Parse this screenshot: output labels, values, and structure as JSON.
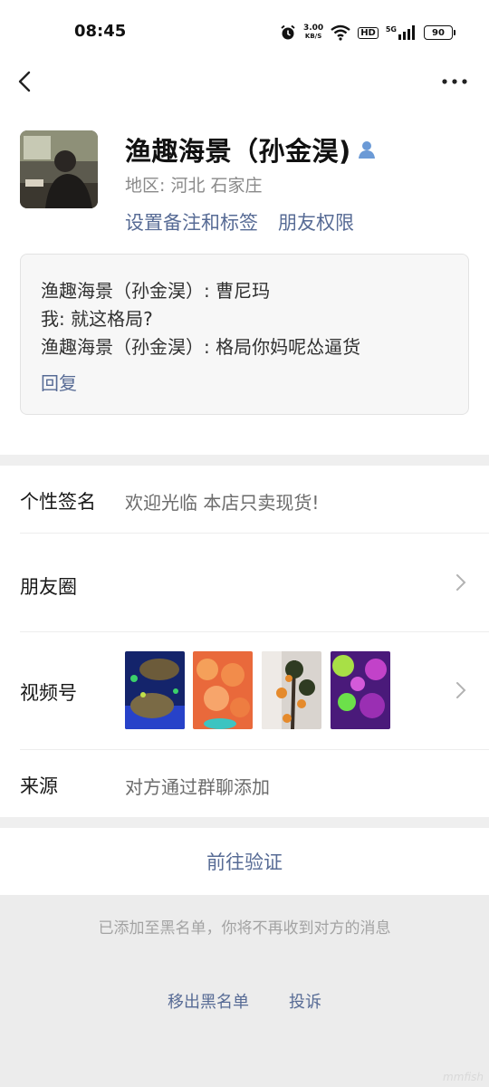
{
  "status_bar": {
    "time": "08:45",
    "net_speed_value": "3.00",
    "net_speed_unit": "KB/S",
    "hd_label": "HD",
    "network_label": "5G",
    "battery": "90"
  },
  "profile": {
    "name": "渔趣海景（孙金淏)",
    "region": "地区: 河北  石家庄",
    "set_remark_label": "设置备注和标签",
    "friend_permission_label": "朋友权限"
  },
  "messages": {
    "lines": [
      "渔趣海景（孙金淏）: 曹尼玛",
      "我: 就这格局?",
      "渔趣海景（孙金淏）: 格局你妈呢怂逼货"
    ],
    "reply_label": "回复"
  },
  "info": {
    "signature_label": "个性签名",
    "signature_value": "欢迎光临 本店只卖现货!",
    "moments_label": "朋友圈",
    "channels_label": "视频号",
    "source_label": "来源",
    "source_value": "对方通过群聊添加"
  },
  "verify_label": "前往验证",
  "blacklist": {
    "notice": "已添加至黑名单，你将不再收到对方的消息",
    "remove_label": "移出黑名单",
    "complain_label": "投诉"
  },
  "watermark": "mmfish",
  "colors": {
    "link": "#576b95",
    "secondary_text": "#8a8a8a",
    "page_gray": "#ececec"
  },
  "icons": [
    "back-icon",
    "more-icon",
    "contact-person-icon",
    "chevron-right-icon",
    "alarm-icon",
    "wifi-icon",
    "signal-icon",
    "battery-icon"
  ]
}
